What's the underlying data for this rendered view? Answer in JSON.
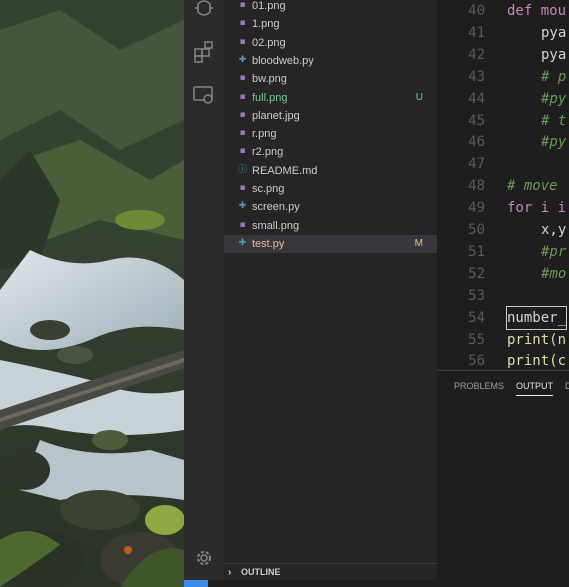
{
  "explorer": {
    "files": [
      {
        "name": "01.png",
        "type": "image",
        "status": ""
      },
      {
        "name": "1.png",
        "type": "image",
        "status": ""
      },
      {
        "name": "02.png",
        "type": "image",
        "status": ""
      },
      {
        "name": "bloodweb.py",
        "type": "python",
        "status": ""
      },
      {
        "name": "bw.png",
        "type": "image",
        "status": ""
      },
      {
        "name": "full.png",
        "type": "image",
        "status": "U"
      },
      {
        "name": "planet.jpg",
        "type": "image",
        "status": ""
      },
      {
        "name": "r.png",
        "type": "image",
        "status": ""
      },
      {
        "name": "r2.png",
        "type": "image",
        "status": ""
      },
      {
        "name": "README.md",
        "type": "info",
        "status": ""
      },
      {
        "name": "sc.png",
        "type": "image",
        "status": ""
      },
      {
        "name": "screen.py",
        "type": "python",
        "status": ""
      },
      {
        "name": "small.png",
        "type": "image",
        "status": ""
      },
      {
        "name": "test.py",
        "type": "python",
        "status": "M"
      }
    ],
    "outline_label": "OUTLINE"
  },
  "editor": {
    "lines": [
      {
        "num": "40",
        "text": "def mou"
      },
      {
        "num": "41",
        "text": "pya"
      },
      {
        "num": "42",
        "text": "pya"
      },
      {
        "num": "43",
        "text": "# p"
      },
      {
        "num": "44",
        "text": "#py"
      },
      {
        "num": "45",
        "text": "# t"
      },
      {
        "num": "46",
        "text": "#py"
      },
      {
        "num": "47",
        "text": ""
      },
      {
        "num": "48",
        "text": "# move"
      },
      {
        "num": "49",
        "text": "for i i"
      },
      {
        "num": "50",
        "text": "x,y"
      },
      {
        "num": "51",
        "text": "#pr"
      },
      {
        "num": "52",
        "text": "#mo"
      },
      {
        "num": "53",
        "text": ""
      },
      {
        "num": "54",
        "text": "number_"
      },
      {
        "num": "55",
        "text": "print(n"
      },
      {
        "num": "56",
        "text": "print(c"
      }
    ]
  },
  "panel": {
    "tabs": [
      "PROBLEMS",
      "OUTPUT",
      "D"
    ]
  },
  "colors": {
    "modified": "#e2c08d",
    "untracked": "#73c991",
    "image_icon": "#a074c4",
    "python_icon": "#519aba",
    "accent": "#3c8ce7"
  }
}
